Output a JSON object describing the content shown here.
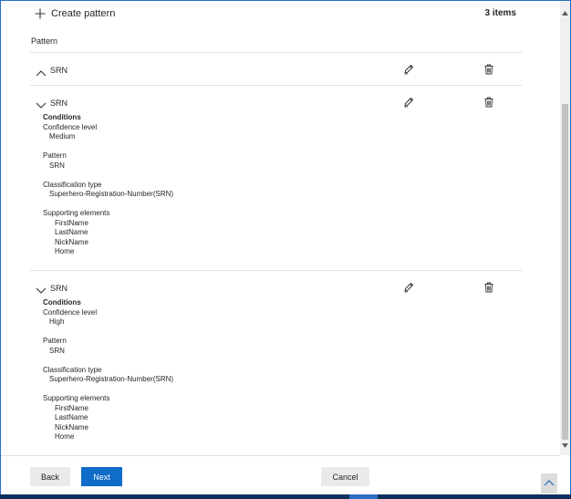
{
  "toolbar": {
    "create_label": "Create pattern",
    "items_count": "3 items"
  },
  "table": {
    "column_header": "Pattern"
  },
  "patterns": [
    {
      "name": "SRN",
      "expanded": false
    },
    {
      "name": "SRN",
      "expanded": true,
      "conditions_label": "Conditions",
      "confidence_label": "Confidence level",
      "confidence_value": "Medium",
      "pattern_label": "Pattern",
      "pattern_value": "SRN",
      "classification_label": "Classification type",
      "classification_value": "Superhero-Registration-Number(SRN)",
      "supporting_label": "Supporting elements",
      "supporting": [
        "FirstName",
        "LastName",
        "NickName",
        "Home"
      ]
    },
    {
      "name": "SRN",
      "expanded": true,
      "conditions_label": "Conditions",
      "confidence_label": "Confidence level",
      "confidence_value": "High",
      "pattern_label": "Pattern",
      "pattern_value": "SRN",
      "classification_label": "Classification type",
      "classification_value": "Superhero-Registration-Number(SRN)",
      "supporting_label": "Supporting elements",
      "supporting": [
        "FirstName",
        "LastName",
        "NickName",
        "Home"
      ]
    }
  ],
  "footer": {
    "back_label": "Back",
    "next_label": "Next",
    "cancel_label": "Cancel"
  },
  "icons": {
    "create": "plus-icon",
    "collapse": "chevron-up-icon",
    "expand": "chevron-down-icon",
    "edit": "pencil-icon",
    "delete": "trash-icon",
    "scroll_top": "chevron-up-icon"
  },
  "colors": {
    "accent": "#0f6cc8",
    "frame": "#2b6cc4",
    "taskbar": "#0d2f5c"
  }
}
